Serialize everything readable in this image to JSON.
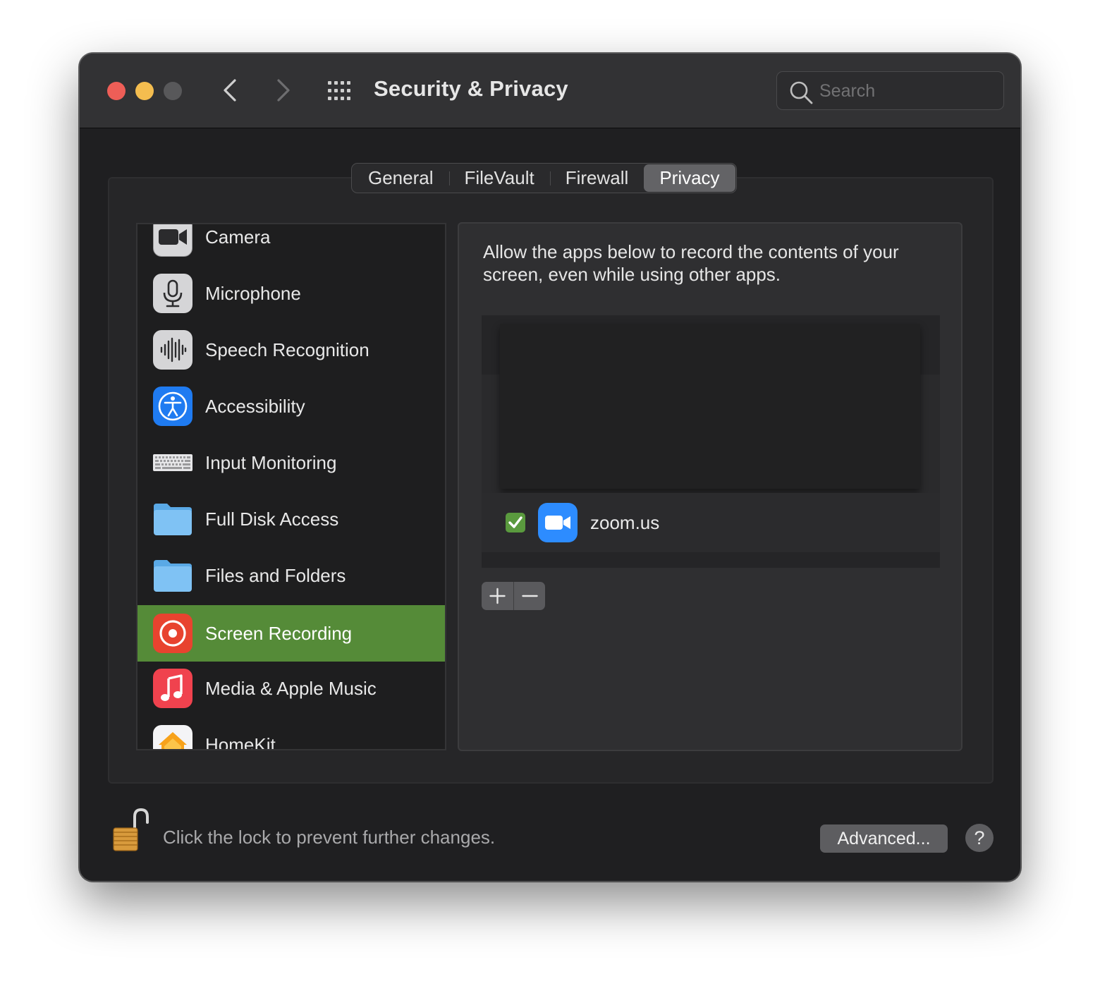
{
  "window": {
    "title": "Security & Privacy"
  },
  "search": {
    "placeholder": "Search"
  },
  "tabs": [
    {
      "label": "General",
      "active": false
    },
    {
      "label": "FileVault",
      "active": false
    },
    {
      "label": "Firewall",
      "active": false
    },
    {
      "label": "Privacy",
      "active": true
    }
  ],
  "categories": [
    {
      "label": "Camera",
      "icon": "camera-icon"
    },
    {
      "label": "Microphone",
      "icon": "microphone-icon"
    },
    {
      "label": "Speech Recognition",
      "icon": "waveform-icon"
    },
    {
      "label": "Accessibility",
      "icon": "accessibility-icon"
    },
    {
      "label": "Input Monitoring",
      "icon": "keyboard-icon"
    },
    {
      "label": "Full Disk Access",
      "icon": "folder-icon"
    },
    {
      "label": "Files and Folders",
      "icon": "folder-icon"
    },
    {
      "label": "Screen Recording",
      "icon": "screen-recording-icon",
      "selected": true
    },
    {
      "label": "Media & Apple Music",
      "icon": "music-note-icon"
    },
    {
      "label": "HomeKit",
      "icon": "home-icon"
    }
  ],
  "detail": {
    "description": "Allow the apps below to record the contents of your screen, even while using other apps.",
    "apps": [
      {
        "name": "zoom.us",
        "checked": true,
        "icon": "zoom-video-icon"
      }
    ],
    "add_symbol": "+",
    "remove_symbol": "—"
  },
  "footer": {
    "lock_text": "Click the lock to prevent further changes.",
    "advanced_label": "Advanced...",
    "help_label": "?"
  },
  "colors": {
    "selection": "#558b38",
    "checkbox": "#5a9a3e",
    "close": "#ee5e57",
    "minimize": "#f4bd4f",
    "accessibility_blue": "#1f7bf1",
    "screen_recording_red": "#e8432f",
    "zoom_blue": "#2d8cff"
  }
}
